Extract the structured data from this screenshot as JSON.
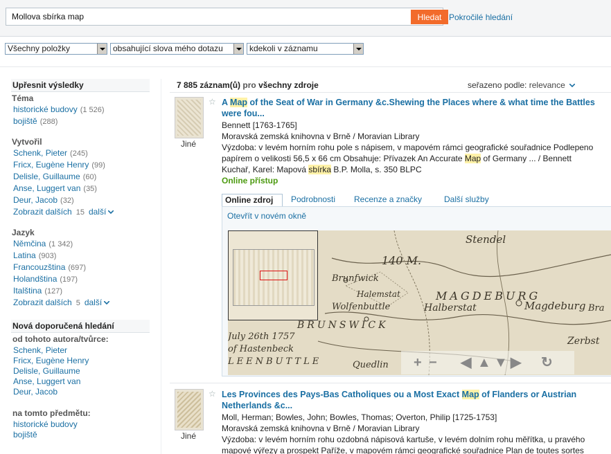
{
  "search": {
    "query": "Mollova sbírka map",
    "button": "Hledat",
    "advanced": "Pokročilé hledání"
  },
  "filters": {
    "items": "Všechny položky",
    "words": "obsahující slova mého dotazu",
    "where": "kdekoli v záznamu"
  },
  "sidebar": {
    "refine_title": "Upřesnit výsledky",
    "topic": {
      "title": "Téma",
      "items": [
        {
          "label": "historické budovy",
          "count": "(1 526)"
        },
        {
          "label": "bojiště",
          "count": "(288)"
        }
      ]
    },
    "creator": {
      "title": "Vytvořil",
      "items": [
        {
          "label": "Schenk, Pieter",
          "count": "(245)"
        },
        {
          "label": "Fricx, Eugène Henry",
          "count": "(99)"
        },
        {
          "label": "Delisle, Guillaume",
          "count": "(60)"
        },
        {
          "label": "Anse, Luggert van",
          "count": "(35)"
        },
        {
          "label": "Deur, Jacob",
          "count": "(32)"
        }
      ],
      "more_label": "Zobrazit dalších",
      "more_count": "15",
      "more_link": "další"
    },
    "language": {
      "title": "Jazyk",
      "items": [
        {
          "label": "Němčina",
          "count": "(1 342)"
        },
        {
          "label": "Latina",
          "count": "(903)"
        },
        {
          "label": "Francouzština",
          "count": "(697)"
        },
        {
          "label": "Holandština",
          "count": "(197)"
        },
        {
          "label": "Italština",
          "count": "(127)"
        }
      ],
      "more_label": "Zobrazit dalších",
      "more_count": "5",
      "more_link": "další"
    },
    "suggest": {
      "title": "Nová doporučená hledání",
      "by_author_label": "od tohoto autora/tvůrce:",
      "by_author": [
        "Schenk, Pieter",
        "Fricx, Eugène Henry",
        "Delisle, Guillaume",
        "Anse, Luggert van",
        "Deur, Jacob"
      ],
      "by_subject_label": "na tomto předmětu:",
      "by_subject": [
        "historické budovy",
        "bojiště"
      ]
    }
  },
  "results": {
    "count": "7 885",
    "count_unit": "záznam(ů)",
    "pro": "pro",
    "scope": "všechny zdroje",
    "sort_label": "seřazeno podle:",
    "sort_value": "relevance"
  },
  "record1": {
    "type": "Jiné",
    "title_a": "A ",
    "title_hl": "Map",
    "title_b": " of the Seat of War in Germany &c.Shewing the Places where & what time the Battles",
    "title_c": "were fou...",
    "author": "Bennett [1763-1765]",
    "library": "Moravská zemská knihovna v Brně / Moravian Library",
    "desc1": "Výzdoba: v levém horním rohu pole s nápisem, v mapovém rámci geografické souřadnice Podlepeno",
    "desc2_a": "papírem o velikosti 56,5 x 66 cm Obsahuje: Přívazek An Accurate ",
    "desc2_hl": "Map",
    "desc2_b": " of Germany ... / Bennett",
    "desc3_a": "Kuchař, Karel: Mapová ",
    "desc3_hl": "sbírka",
    "desc3_b": " B.P. Molla, s. 350 BLPC",
    "online": "Online přístup",
    "tabs": [
      "Online zdroj",
      "Podrobnosti",
      "Recenze a značky",
      "Další služby"
    ],
    "open_new": "Otevřít v novém okně",
    "map_labels": {
      "stendel": "Stendel",
      "lib": "140 M.",
      "brunswick": "Brunfwick",
      "halemstat": "Halemstat",
      "wolfenbuttle": "Wolfenbuttle",
      "halberstat": "Halberstat",
      "magdeburg_caps": "MAGDEBURG",
      "magdeburg": "Magdeburg",
      "brunswick_caps": "BRUNSWICK",
      "july": "July 26th 1757",
      "hastenbeck": "of Hastenbeck",
      "battle": "LEENBUTTLE",
      "quedlin": "Quedlin",
      "zerbst": "Zerbst",
      "bra": "Bra"
    }
  },
  "record2": {
    "type": "Jiné",
    "title_a": "Les Provinces des Pays-Bas Catholiques ou a Most Exact ",
    "title_hl": "Map",
    "title_b": " of Flanders or Austrian",
    "title_c": "Netherlands &c...",
    "author": "Moll, Herman; Bowles, John; Bowles, Thomas; Overton, Philip [1725-1753]",
    "library": "Moravská zemská knihovna v Brně / Moravian Library",
    "desc1": "Výzdoba: v levém horním rohu ozdobná nápisová kartuše, v levém dolním rohu měřítka, u pravého",
    "desc2": "mapové výřezy a prospekt Paříže, v mapovém rámci geografické souřadnice Plan de toutes sortes"
  }
}
